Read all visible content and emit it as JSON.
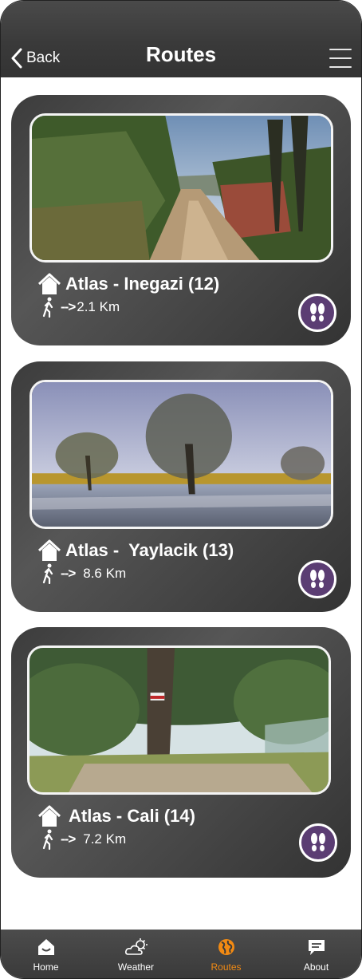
{
  "header": {
    "back_label": "Back",
    "title": "Routes"
  },
  "routes": [
    {
      "name": "Atlas - Inegazi (12)",
      "arrow": "-->",
      "distance": "2.1 Km"
    },
    {
      "name": "Atlas -  Yaylacik (13)",
      "arrow": "-->",
      "distance": "8.6 Km"
    },
    {
      "name": "Atlas - Cali (14)",
      "arrow": "-->",
      "distance": "7.2 Km"
    }
  ],
  "tabs": [
    {
      "label": "Home",
      "icon": "home-icon"
    },
    {
      "label": "Weather",
      "icon": "weather-icon"
    },
    {
      "label": "Routes",
      "icon": "globe-icon",
      "active": true
    },
    {
      "label": "About",
      "icon": "chat-icon"
    }
  ],
  "colors": {
    "accent": "#f28a13",
    "button_purple": "#5b3d73",
    "card": "#3f3f3f"
  }
}
